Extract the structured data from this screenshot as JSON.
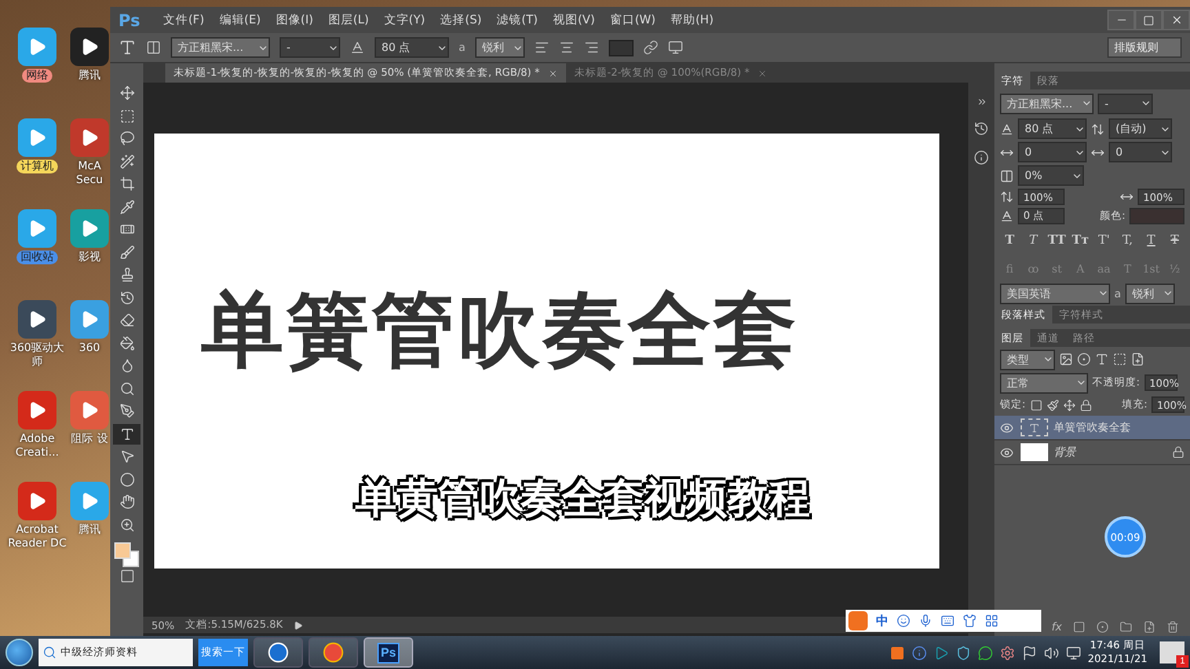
{
  "desktop_icons": [
    {
      "label": "网络",
      "color": "#f08a80"
    },
    {
      "label": "腾讯"
    },
    {
      "label": "计算机",
      "color": "#f5d65a"
    },
    {
      "label": "McA Secu"
    },
    {
      "label": "回收站",
      "color": "#4a8fe8"
    },
    {
      "label": "影视"
    },
    {
      "label": "360驱动大师"
    },
    {
      "label": "360"
    },
    {
      "label": "Adobe Creati..."
    },
    {
      "label": "阻际 设"
    },
    {
      "label": "Acrobat Reader DC"
    },
    {
      "label": "腾讯"
    }
  ],
  "window": {
    "logo": "Ps",
    "menu": [
      "文件(F)",
      "编辑(E)",
      "图像(I)",
      "图层(L)",
      "文字(Y)",
      "选择(S)",
      "滤镜(T)",
      "视图(V)",
      "窗口(W)",
      "帮助(H)"
    ]
  },
  "options_bar": {
    "font": "方正粗黑宋...",
    "style": "-",
    "size": "80 点",
    "antialias_icon": "a",
    "antialias": "锐利",
    "workspace_button": "排版规则"
  },
  "document_tabs": [
    {
      "label": "未标题-1-恢复的-恢复的-恢复的-恢复的 @ 50% (单簧管吹奏全套, RGB/8) *",
      "selected": true
    },
    {
      "label": "未标题-2-恢复的 @ 100%(RGB/8) *",
      "selected": false
    }
  ],
  "tools": [
    {
      "selected": false
    },
    {
      "selected": false
    },
    {
      "selected": false
    },
    {
      "selected": false
    },
    {
      "selected": false
    },
    {
      "selected": false
    },
    {
      "selected": false
    },
    {
      "selected": false
    },
    {
      "selected": false
    },
    {
      "selected": false
    },
    {
      "selected": false
    },
    {
      "selected": false
    },
    {
      "selected": false
    },
    {
      "selected": false
    },
    {
      "selected": false
    },
    {
      "selected": true
    },
    {
      "selected": false
    },
    {
      "selected": false
    },
    {
      "selected": false
    },
    {
      "selected": false
    }
  ],
  "canvas": {
    "text": "单簧管吹奏全套"
  },
  "subtitle": "单黄管吹奏全套视频教程",
  "status_bar": {
    "zoom": "50%",
    "document": "文档:5.15M/625.8K"
  },
  "character_panel": {
    "tabs": [
      {
        "label": "字符",
        "selected": true
      },
      {
        "label": "段落",
        "selected": false
      }
    ],
    "font": "方正粗黑宋...",
    "style": "-",
    "size": "80 点",
    "leading": "(自动)",
    "kerning": "0",
    "tracking": "0",
    "tsume": "0%",
    "vertical_scale": "100%",
    "horizontal_scale": "100%",
    "baseline_shift": "0 点",
    "color_label": "颜色:",
    "style_buttons": [
      "T",
      "T",
      "TT",
      "Tт",
      "T'",
      "T,",
      "T",
      "Ŧ"
    ],
    "opentype_buttons": [
      "fi",
      "ꝏ",
      "st",
      "A",
      "aa",
      "T",
      "1st",
      "½"
    ],
    "language": "美国英语",
    "antialias_icon": "a",
    "antialias": "锐利"
  },
  "style_tabs": [
    {
      "label": "段落样式",
      "selected": true
    },
    {
      "label": "字符样式",
      "selected": false
    }
  ],
  "layers_panel": {
    "tabs": [
      {
        "label": "图层",
        "selected": true
      },
      {
        "label": "通道",
        "selected": false
      },
      {
        "label": "路径",
        "selected": false
      }
    ],
    "filter": "类型",
    "blend_mode": "正常",
    "opacity_label": "不透明度:",
    "opacity": "100%",
    "lock_label": "锁定:",
    "fill_label": "填充:",
    "fill": "100%",
    "layers": [
      {
        "kind": "text",
        "name": "单簧管吹奏全套",
        "selected": true,
        "visible": true,
        "locked": false
      },
      {
        "kind": "image",
        "name": "背景",
        "selected": false,
        "visible": true,
        "locked": true
      }
    ],
    "footer_label": "fx"
  },
  "timer_badge": "00:09",
  "ime_bar": {
    "mode": "中"
  },
  "taskbar": {
    "search_value": "中级经济师资料",
    "search_button": "搜索一下",
    "apps": [
      {
        "kind": "browser",
        "selected": false
      },
      {
        "kind": "chrome",
        "selected": false
      },
      {
        "kind": "photoshop",
        "label": "Ps",
        "selected": true
      }
    ],
    "time": "17:46 周日",
    "date": "2021/11/21",
    "notification_count": "1"
  }
}
